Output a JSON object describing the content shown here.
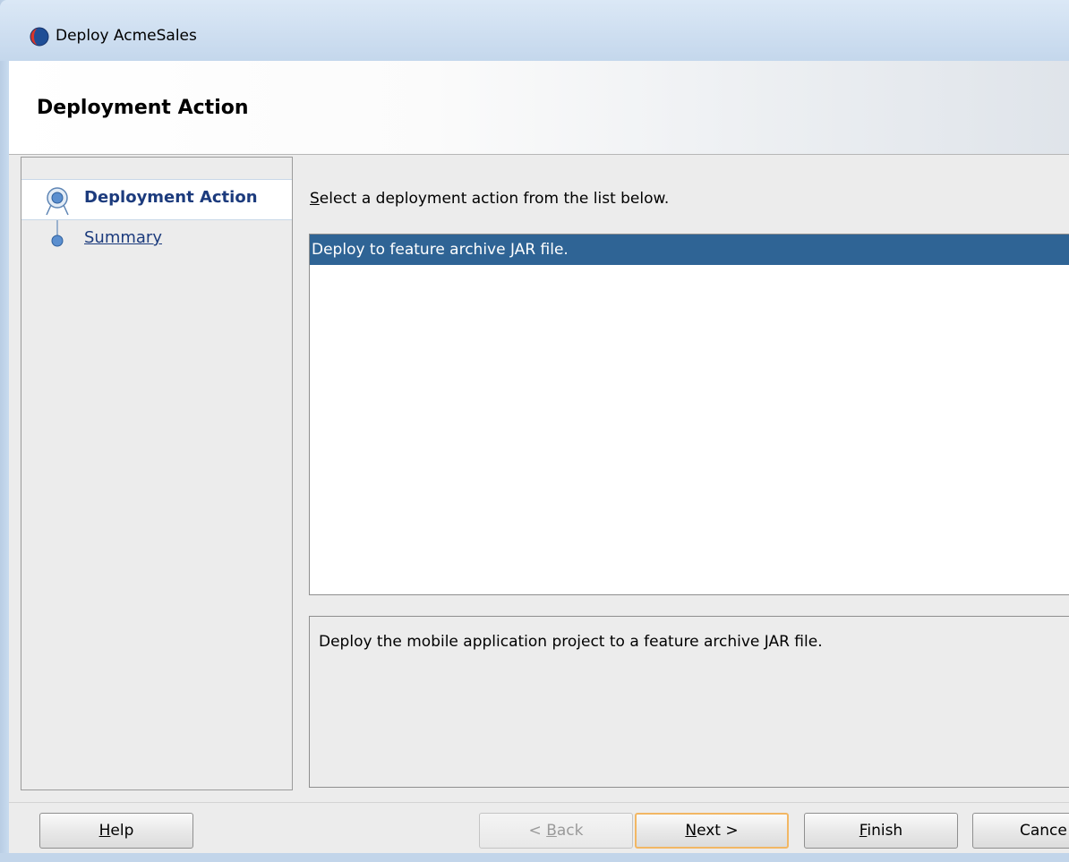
{
  "window": {
    "title": "Deploy AcmeSales",
    "icon": "jdeveloper-app-icon"
  },
  "header": {
    "title": "Deployment Action"
  },
  "nav": {
    "items": [
      {
        "label": "Deployment Action",
        "state": "current"
      },
      {
        "label": "Summary",
        "state": "link"
      }
    ]
  },
  "main": {
    "prompt_mnemonic": "S",
    "prompt_rest": "elect a deployment action from the list below.",
    "actions": [
      "Deploy to feature archive JAR file."
    ],
    "selected_index": 0,
    "description": "Deploy the mobile application project to a feature archive JAR file."
  },
  "buttons": {
    "help": {
      "mn": "H",
      "rest": "elp"
    },
    "back": {
      "prefix": "< ",
      "mn": "B",
      "rest": "ack",
      "enabled": false
    },
    "next": {
      "mn": "N",
      "rest": "ext >",
      "focused": true
    },
    "finish": {
      "mn": "F",
      "rest": "inish"
    },
    "cancel": {
      "label": "Cance"
    }
  },
  "colors": {
    "selection": "#2f6495",
    "nav_text": "#1c3b7d",
    "focus_border": "#f2b764",
    "frame": "#c2d5ea"
  }
}
